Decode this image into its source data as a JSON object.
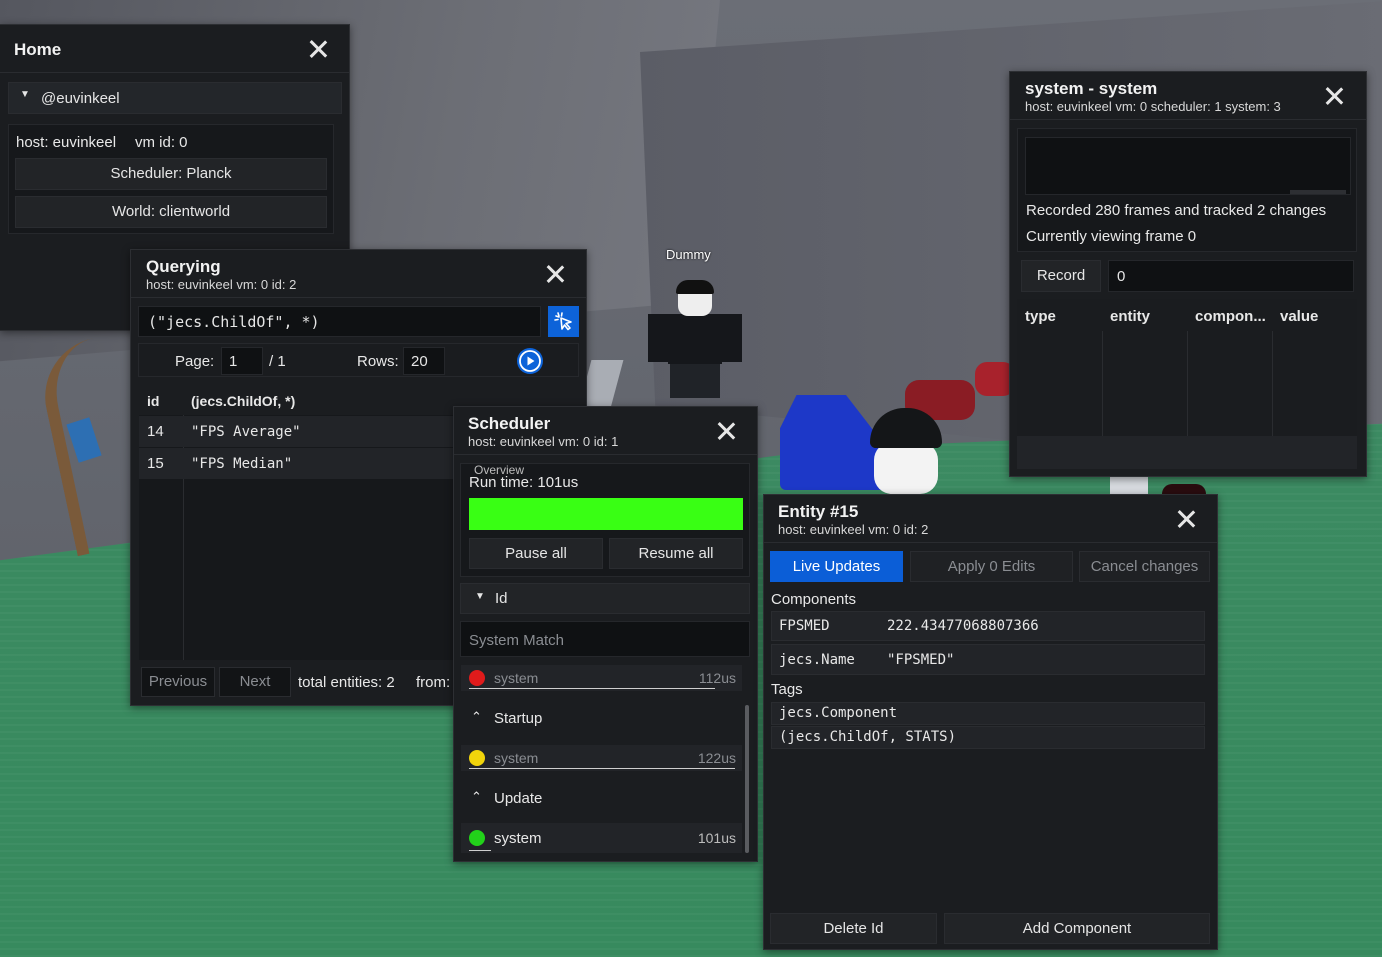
{
  "scene": {
    "dummy_label": "Dummy"
  },
  "home": {
    "title": "Home",
    "user": "@euvinkeel",
    "host_label": "host: euvinkeel",
    "vm_label": "vm id: 0",
    "scheduler_button": "Scheduler: Planck",
    "world_button": "World: clientworld"
  },
  "querying": {
    "title": "Querying",
    "subtitle": "host: euvinkeel vm: 0 id: 2",
    "query": "(\"jecs.ChildOf\", *)",
    "page_label": "Page:",
    "page_value": "1",
    "page_total": "/ 1",
    "rows_label": "Rows:",
    "rows_value": "20",
    "columns": [
      "id",
      "(jecs.ChildOf, *)"
    ],
    "rows": [
      {
        "id": "14",
        "value": "\"FPS Average\""
      },
      {
        "id": "15",
        "value": "\"FPS Median\""
      }
    ],
    "previous": "Previous",
    "next": "Next",
    "total": "total entities: 2",
    "from": "from:"
  },
  "scheduler": {
    "title": "Scheduler",
    "subtitle": "host: euvinkeel vm: 0 id: 1",
    "overview_label": "Overview",
    "run_time": "Run time: 101us",
    "run_time_fill": 1.0,
    "bar_color": "#39ff14",
    "pause_all": "Pause all",
    "resume_all": "Resume all",
    "id_section": "Id",
    "system_match": "System Match",
    "groups": [
      {
        "name": "",
        "system": "system",
        "time": "112us",
        "color": "#e01b1b"
      },
      {
        "name": "Startup",
        "system": "system",
        "time": "122us",
        "color": "#f1d40b"
      },
      {
        "name": "Update",
        "system": "system",
        "time": "101us",
        "color": "#22d21a"
      }
    ]
  },
  "system": {
    "title": "system - system",
    "subtitle": "host: euvinkeel vm: 0 scheduler: 1 system: 3",
    "recorded": "Recorded 280 frames and tracked 2 changes",
    "viewing": "Currently viewing frame 0",
    "record_button": "Record",
    "frame_value": "0",
    "columns": [
      "type",
      "entity",
      "compon...",
      "value"
    ]
  },
  "entity": {
    "title": "Entity #15",
    "subtitle": "host: euvinkeel vm: 0 id: 2",
    "live_updates": "Live Updates",
    "apply_edits": "Apply 0 Edits",
    "cancel_changes": "Cancel changes",
    "components_label": "Components",
    "components": [
      {
        "name": "FPSMED",
        "value": "222.43477068807366"
      },
      {
        "name": "jecs.Name",
        "value": "\"FPSMED\""
      }
    ],
    "tags_label": "Tags",
    "tags": [
      "jecs.Component",
      "(jecs.ChildOf, STATS)"
    ],
    "delete_id": "Delete Id",
    "add_component": "Add Component",
    "accent": "#0b5ed7"
  }
}
